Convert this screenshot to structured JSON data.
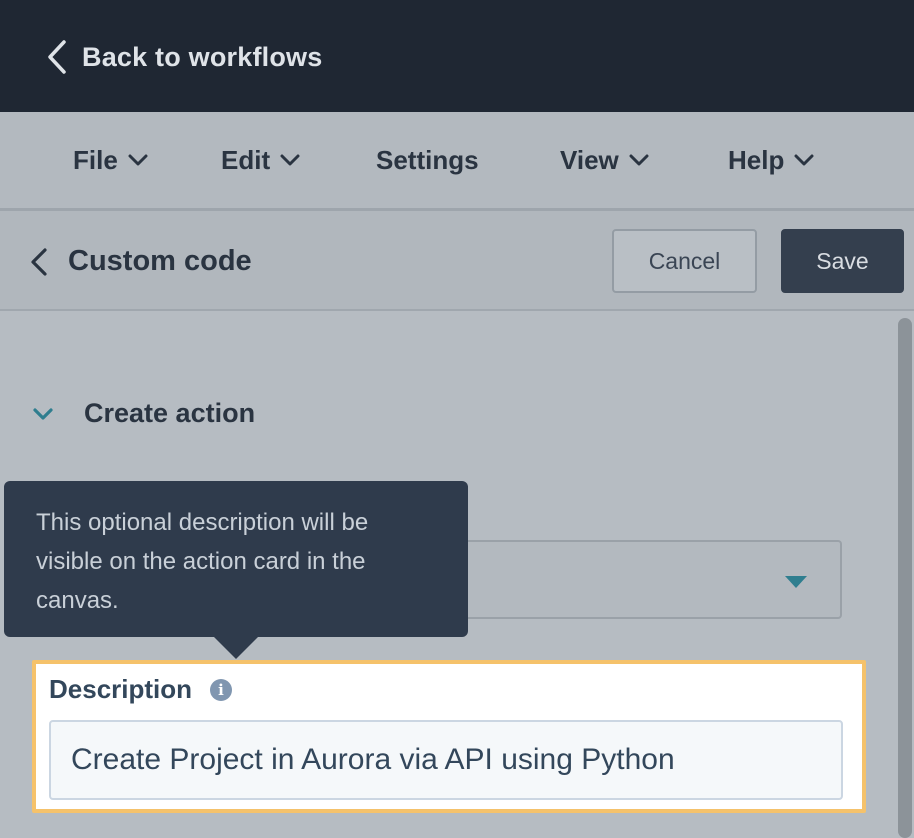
{
  "topbar": {
    "back_label": "Back to workflows"
  },
  "menu": {
    "items": [
      {
        "label": "File",
        "has_dropdown": true
      },
      {
        "label": "Edit",
        "has_dropdown": true
      },
      {
        "label": "Settings",
        "has_dropdown": false
      },
      {
        "label": "View",
        "has_dropdown": true
      },
      {
        "label": "Help",
        "has_dropdown": true
      }
    ]
  },
  "panel": {
    "title": "Custom code",
    "cancel_label": "Cancel",
    "save_label": "Save"
  },
  "section": {
    "title": "Create action"
  },
  "tooltip": {
    "text": "This optional description will be visible on the action card in the canvas."
  },
  "description": {
    "label": "Description",
    "value": "Create Project in Aurora via API using Python"
  },
  "colors": {
    "topbar_bg": "#1f2733",
    "save_bg": "#343f4e",
    "highlight_border": "#f5c26b",
    "tooltip_bg": "#2f3b4c",
    "accent_chevron": "#2f7e8f"
  },
  "icons": {
    "back": "chevron-left-icon",
    "dropdown": "chevron-down-icon",
    "select": "caret-down-icon",
    "info": "info-icon"
  }
}
